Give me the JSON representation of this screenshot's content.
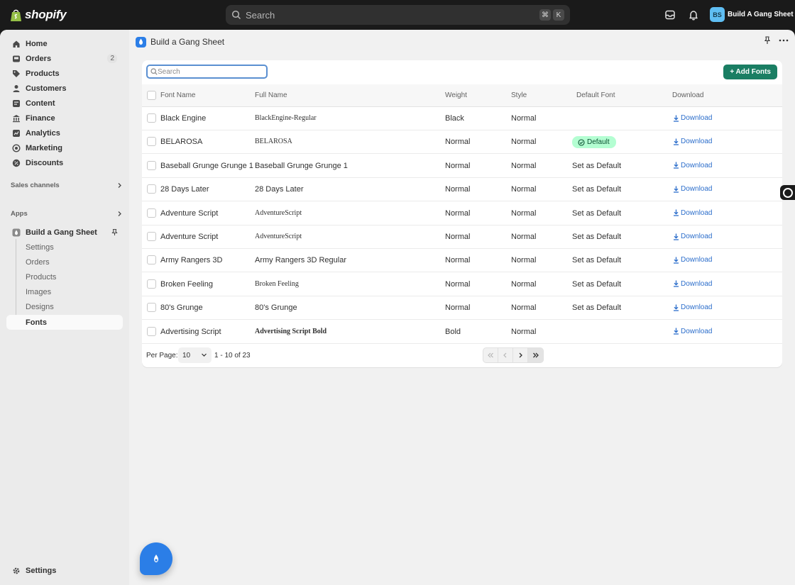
{
  "topbar": {
    "brand": "shopify",
    "search_placeholder": "Search",
    "shortcut_keys": [
      "⌘",
      "K"
    ],
    "store_initials": "BS",
    "store_name": "Build A Gang Sheet"
  },
  "sidebar": {
    "items": [
      {
        "label": "Home",
        "icon": "home-icon"
      },
      {
        "label": "Orders",
        "icon": "inbox-icon",
        "badge": "2"
      },
      {
        "label": "Products",
        "icon": "tag-icon"
      },
      {
        "label": "Customers",
        "icon": "person-icon"
      },
      {
        "label": "Content",
        "icon": "content-icon"
      },
      {
        "label": "Finance",
        "icon": "bank-icon"
      },
      {
        "label": "Analytics",
        "icon": "chart-icon"
      },
      {
        "label": "Marketing",
        "icon": "target-icon"
      },
      {
        "label": "Discounts",
        "icon": "discount-icon"
      }
    ],
    "sales_channels_label": "Sales channels",
    "apps_label": "Apps",
    "app": {
      "label": "Build a Gang Sheet",
      "subitems": [
        "Settings",
        "Orders",
        "Products",
        "Images",
        "Designs",
        "Fonts"
      ]
    },
    "settings_label": "Settings"
  },
  "app_header": {
    "title": "Build a Gang Sheet"
  },
  "fonts_table": {
    "search_placeholder": "Search",
    "add_button": "+ Add Fonts",
    "columns": [
      "Font Name",
      "Full Name",
      "Weight",
      "Style",
      "Default Font",
      "Download"
    ],
    "rows": [
      {
        "font_name": "Black Engine",
        "full_name": "BlackEngine-Regular",
        "weight": "Black",
        "style": "Normal",
        "default": "",
        "download": "Download"
      },
      {
        "font_name": "BELAROSA",
        "full_name": "BELAROSA",
        "weight": "Normal",
        "style": "Normal",
        "default": "Default",
        "download": "Download"
      },
      {
        "font_name": "Baseball Grunge Grunge 1",
        "full_name": "Baseball Grunge Grunge 1",
        "weight": "Normal",
        "style": "Normal",
        "default": "Set as Default",
        "download": "Download"
      },
      {
        "font_name": "28 Days Later",
        "full_name": "28 Days Later",
        "weight": "Normal",
        "style": "Normal",
        "default": "Set as Default",
        "download": "Download"
      },
      {
        "font_name": "Adventure Script",
        "full_name": "AdventureScript",
        "weight": "Normal",
        "style": "Normal",
        "default": "Set as Default",
        "download": "Download"
      },
      {
        "font_name": "Adventure Script",
        "full_name": "AdventureScript",
        "weight": "Normal",
        "style": "Normal",
        "default": "Set as Default",
        "download": "Download"
      },
      {
        "font_name": "Army Rangers 3D",
        "full_name": "Army Rangers 3D Regular",
        "weight": "Normal",
        "style": "Normal",
        "default": "Set as Default",
        "download": "Download"
      },
      {
        "font_name": "Broken Feeling",
        "full_name": "Broken Feeling",
        "weight": "Normal",
        "style": "Normal",
        "default": "Set as Default",
        "download": "Download"
      },
      {
        "font_name": "80's Grunge",
        "full_name": "80's Grunge",
        "weight": "Normal",
        "style": "Normal",
        "default": "Set as Default",
        "download": "Download"
      },
      {
        "font_name": "Advertising Script",
        "full_name": "Advertising Script Bold",
        "weight": "Bold",
        "style": "Normal",
        "default": "",
        "download": "Download"
      }
    ],
    "pagination": {
      "per_page_label": "Per Page:",
      "per_page_value": "10",
      "range_text": "1 - 10 of 23"
    }
  },
  "colors": {
    "accent": "#2b7ee7",
    "primary_button": "#1a7e63",
    "link": "#2c6ecb",
    "default_badge": "#b4fed2"
  }
}
